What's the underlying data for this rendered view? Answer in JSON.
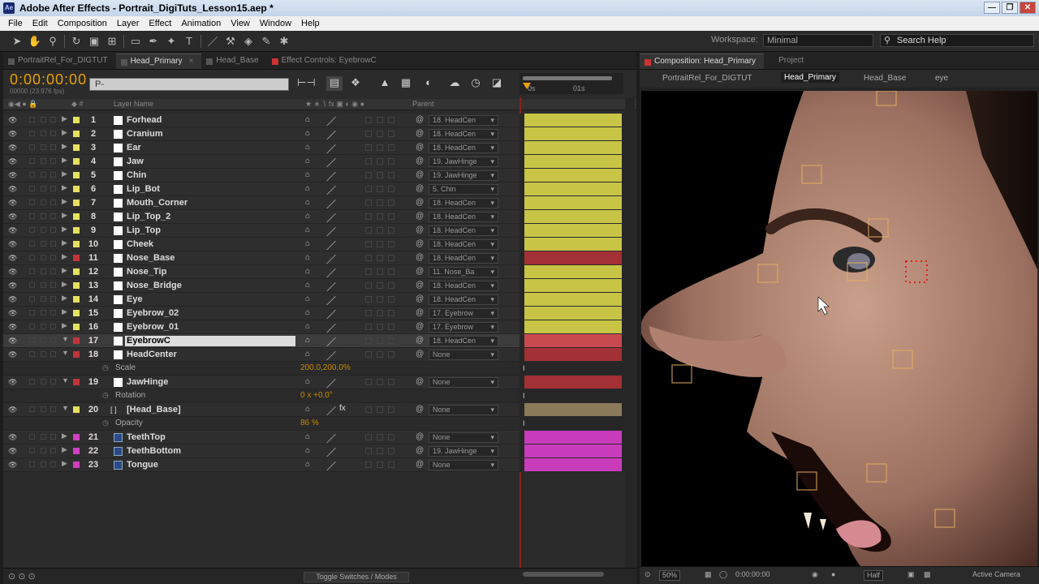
{
  "window": {
    "title": "Adobe After Effects - Portrait_DigiTuts_Lesson15.aep *",
    "app_icon": "Ae",
    "buttons": [
      "—",
      "❐",
      "✕"
    ]
  },
  "menu": [
    "File",
    "Edit",
    "Composition",
    "Layer",
    "Effect",
    "Animation",
    "View",
    "Window",
    "Help"
  ],
  "toolbar": {
    "workspace_label": "Workspace:",
    "workspace_value": "Minimal",
    "search_placeholder": "Search Help"
  },
  "left_tabs": [
    {
      "label": "PortraitRel_For_DIGTUT",
      "swatch": "gray"
    },
    {
      "label": "Head_Primary",
      "swatch": "gray",
      "active": true
    },
    {
      "label": "Head_Base",
      "swatch": "gray"
    },
    {
      "label": "Effect Controls: EyebrowC",
      "swatch": "red"
    }
  ],
  "timeline": {
    "timecode": "0:00:00:00",
    "fps": "00000 (23.976 fps)",
    "search_placeholder": "P-",
    "ruler_start": "0s",
    "ruler_mark": "01s",
    "col_layer_name": "Layer Name",
    "col_parent": "Parent",
    "toggle": "Toggle Switches / Modes"
  },
  "layers": [
    {
      "num": "1",
      "name": "Forhead",
      "parent": "18. HeadCen",
      "color": "#e8e060",
      "bar": "#c8c446",
      "row": "layer"
    },
    {
      "num": "2",
      "name": "Cranium",
      "parent": "18. HeadCen",
      "color": "#e8e060",
      "bar": "#c8c446",
      "row": "layer"
    },
    {
      "num": "3",
      "name": "Ear",
      "parent": "18. HeadCen",
      "color": "#e8e060",
      "bar": "#c8c446",
      "row": "layer"
    },
    {
      "num": "4",
      "name": "Jaw",
      "parent": "19. JawHinge",
      "color": "#e8e060",
      "bar": "#c8c446",
      "row": "layer"
    },
    {
      "num": "5",
      "name": "Chin",
      "parent": "19. JawHinge",
      "color": "#e8e060",
      "bar": "#c8c446",
      "row": "layer"
    },
    {
      "num": "6",
      "name": "Lip_Bot",
      "parent": "5. Chin",
      "color": "#e8e060",
      "bar": "#c8c446",
      "row": "layer"
    },
    {
      "num": "7",
      "name": "Mouth_Corner",
      "parent": "18. HeadCen",
      "color": "#e8e060",
      "bar": "#c8c446",
      "row": "layer"
    },
    {
      "num": "8",
      "name": "Lip_Top_2",
      "parent": "18. HeadCen",
      "color": "#e8e060",
      "bar": "#c8c446",
      "row": "layer"
    },
    {
      "num": "9",
      "name": "Lip_Top",
      "parent": "18. HeadCen",
      "color": "#e8e060",
      "bar": "#c8c446",
      "row": "layer"
    },
    {
      "num": "10",
      "name": "Cheek",
      "parent": "18. HeadCen",
      "color": "#e8e060",
      "bar": "#c8c446",
      "row": "layer"
    },
    {
      "num": "11",
      "name": "Nose_Base",
      "parent": "18. HeadCen",
      "color": "#c0353a",
      "bar": "#a33034",
      "row": "layer"
    },
    {
      "num": "12",
      "name": "Nose_Tip",
      "parent": "11. Nose_Ba",
      "color": "#e8e060",
      "bar": "#c8c446",
      "row": "layer"
    },
    {
      "num": "13",
      "name": "Nose_Bridge",
      "parent": "18. HeadCen",
      "color": "#e8e060",
      "bar": "#c8c446",
      "row": "layer"
    },
    {
      "num": "14",
      "name": "Eye",
      "parent": "18. HeadCen",
      "color": "#e8e060",
      "bar": "#c8c446",
      "row": "layer"
    },
    {
      "num": "15",
      "name": "Eyebrow_02",
      "parent": "17. Eyebrow",
      "color": "#e8e060",
      "bar": "#c8c446",
      "row": "layer"
    },
    {
      "num": "16",
      "name": "Eyebrow_01",
      "parent": "17. Eyebrow",
      "color": "#e8e060",
      "bar": "#c8c446",
      "row": "layer"
    },
    {
      "num": "17",
      "name": "EyebrowC",
      "parent": "18. HeadCen",
      "color": "#c0353a",
      "bar": "#c84a4e",
      "row": "selected"
    },
    {
      "num": "18",
      "name": "HeadCenter",
      "parent": "None",
      "color": "#c0353a",
      "bar": "#a33034",
      "row": "layer"
    },
    {
      "name": "Scale",
      "value": "200.0,200.0%",
      "row": "prop"
    },
    {
      "num": "19",
      "name": "JawHinge",
      "parent": "None",
      "color": "#c0353a",
      "bar": "#a33034",
      "row": "layer"
    },
    {
      "name": "Rotation",
      "value": "0 x +0.0°",
      "row": "prop"
    },
    {
      "num": "20",
      "name": "[Head_Base]",
      "parent": "None",
      "color": "#e8e060",
      "bar": "#8a7a5a",
      "row": "comp"
    },
    {
      "name": "Opacity",
      "value": "86 %",
      "row": "prop"
    },
    {
      "num": "21",
      "name": "TeethTop",
      "parent": "None",
      "color": "#d040c0",
      "bar": "#c83cbc",
      "row": "pre"
    },
    {
      "num": "22",
      "name": "TeethBottom",
      "parent": "19. JawHinge",
      "color": "#d040c0",
      "bar": "#c83cbc",
      "row": "pre"
    },
    {
      "num": "23",
      "name": "Tongue",
      "parent": "None",
      "color": "#d040c0",
      "bar": "#c83cbc",
      "row": "pre"
    }
  ],
  "right_tabs": {
    "comp_tab": "Composition: Head_Primary",
    "project_tab": "Project"
  },
  "flowchart": {
    "items": [
      "PortraitRel_For_DIGTUT",
      "Head_Primary",
      "Head_Base",
      "eye"
    ]
  },
  "viewer_bar": {
    "zoom": "50%",
    "timecode": "0:00:00:00",
    "resolution": "Half",
    "camera": "Active Camera"
  }
}
